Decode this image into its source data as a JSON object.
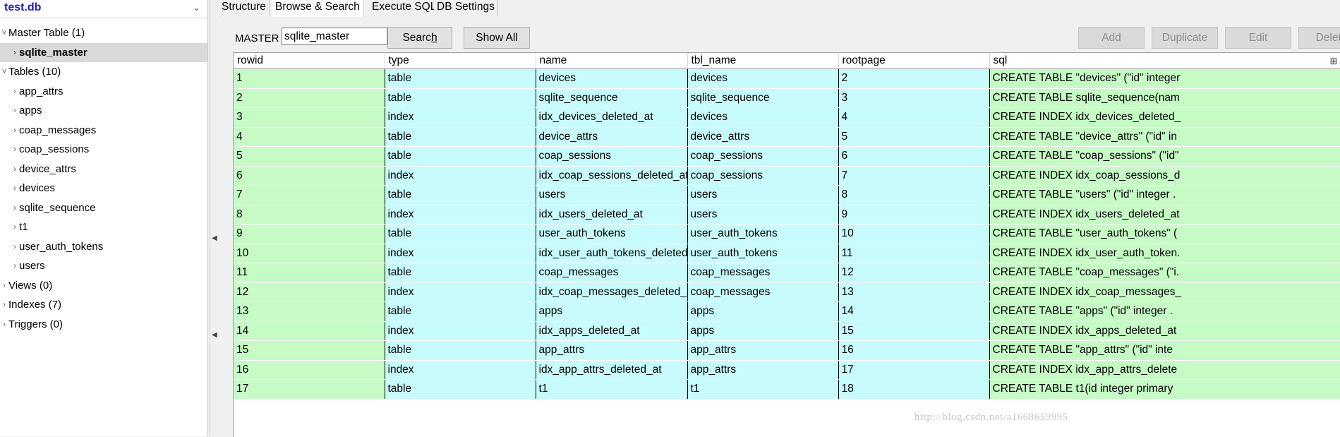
{
  "db": {
    "name": "test.db",
    "chevron": "chevron-down-icon"
  },
  "tree": [
    {
      "label": "Master Table (1)",
      "level": 0,
      "expanded": true
    },
    {
      "label": "sqlite_master",
      "level": 1,
      "expanded": false,
      "selected": true
    },
    {
      "label": "Tables (10)",
      "level": 0,
      "expanded": true
    },
    {
      "label": "app_attrs",
      "level": 1,
      "expanded": false
    },
    {
      "label": "apps",
      "level": 1,
      "expanded": false
    },
    {
      "label": "coap_messages",
      "level": 1,
      "expanded": false
    },
    {
      "label": "coap_sessions",
      "level": 1,
      "expanded": false
    },
    {
      "label": "device_attrs",
      "level": 1,
      "expanded": false
    },
    {
      "label": "devices",
      "level": 1,
      "expanded": false
    },
    {
      "label": "sqlite_sequence",
      "level": 1,
      "expanded": false
    },
    {
      "label": "t1",
      "level": 1,
      "expanded": false
    },
    {
      "label": "user_auth_tokens",
      "level": 1,
      "expanded": false
    },
    {
      "label": "users",
      "level": 1,
      "expanded": false
    },
    {
      "label": "Views (0)",
      "level": 0,
      "expanded": false
    },
    {
      "label": "Indexes (7)",
      "level": 0,
      "expanded": false
    },
    {
      "label": "Triggers (0)",
      "level": 0,
      "expanded": false
    }
  ],
  "tabs": [
    "Structure",
    "Browse & Search",
    "Execute SQL",
    "DB Settings"
  ],
  "active_tab": 1,
  "toolbar": {
    "master_label": "MASTER",
    "master_value": "sqlite_master",
    "search_label_pre": "Searc",
    "search_label_ul": "h",
    "show_all_label": "Show All",
    "add_label": "Add",
    "duplicate_label": "Duplicate",
    "edit_label": "Edit",
    "delete_label": "Delete"
  },
  "grid": {
    "columns": [
      "rowid",
      "type",
      "name",
      "tbl_name",
      "rootpage",
      "sql"
    ],
    "rows": [
      [
        "1",
        "table",
        "devices",
        "devices",
        "2",
        "CREATE TABLE \"devices\" (\"id\" integer"
      ],
      [
        "2",
        "table",
        "sqlite_sequence",
        "sqlite_sequence",
        "3",
        "CREATE TABLE sqlite_sequence(nam"
      ],
      [
        "3",
        "index",
        "idx_devices_deleted_at",
        "devices",
        "4",
        "CREATE INDEX idx_devices_deleted_"
      ],
      [
        "4",
        "table",
        "device_attrs",
        "device_attrs",
        "5",
        "CREATE TABLE \"device_attrs\" (\"id\" in"
      ],
      [
        "5",
        "table",
        "coap_sessions",
        "coap_sessions",
        "6",
        "CREATE TABLE \"coap_sessions\" (\"id\""
      ],
      [
        "6",
        "index",
        "idx_coap_sessions_deleted_at",
        "coap_sessions",
        "7",
        "CREATE INDEX idx_coap_sessions_d"
      ],
      [
        "7",
        "table",
        "users",
        "users",
        "8",
        "CREATE TABLE \"users\" (\"id\" integer ."
      ],
      [
        "8",
        "index",
        "idx_users_deleted_at",
        "users",
        "9",
        "CREATE INDEX idx_users_deleted_at"
      ],
      [
        "9",
        "table",
        "user_auth_tokens",
        "user_auth_tokens",
        "10",
        "CREATE TABLE \"user_auth_tokens\" ("
      ],
      [
        "10",
        "index",
        "idx_user_auth_tokens_deleted_at",
        "user_auth_tokens",
        "11",
        "CREATE INDEX idx_user_auth_token."
      ],
      [
        "11",
        "table",
        "coap_messages",
        "coap_messages",
        "12",
        "CREATE TABLE \"coap_messages\" (\"i."
      ],
      [
        "12",
        "index",
        "idx_coap_messages_deleted_at",
        "coap_messages",
        "13",
        "CREATE INDEX idx_coap_messages_"
      ],
      [
        "13",
        "table",
        "apps",
        "apps",
        "14",
        "CREATE TABLE \"apps\" (\"id\" integer ."
      ],
      [
        "14",
        "index",
        "idx_apps_deleted_at",
        "apps",
        "15",
        "CREATE INDEX idx_apps_deleted_at"
      ],
      [
        "15",
        "table",
        "app_attrs",
        "app_attrs",
        "16",
        "CREATE TABLE \"app_attrs\" (\"id\" inte"
      ],
      [
        "16",
        "index",
        "idx_app_attrs_deleted_at",
        "app_attrs",
        "17",
        "CREATE INDEX idx_app_attrs_delete"
      ],
      [
        "17",
        "table",
        "t1",
        "t1",
        "18",
        "CREATE TABLE t1(id integer primary"
      ]
    ],
    "cell_colors": {
      "green": "#c6fbc6",
      "cyan": "#c8fbfb"
    }
  },
  "watermark": "http://blog.csdn.net/a1668659995"
}
